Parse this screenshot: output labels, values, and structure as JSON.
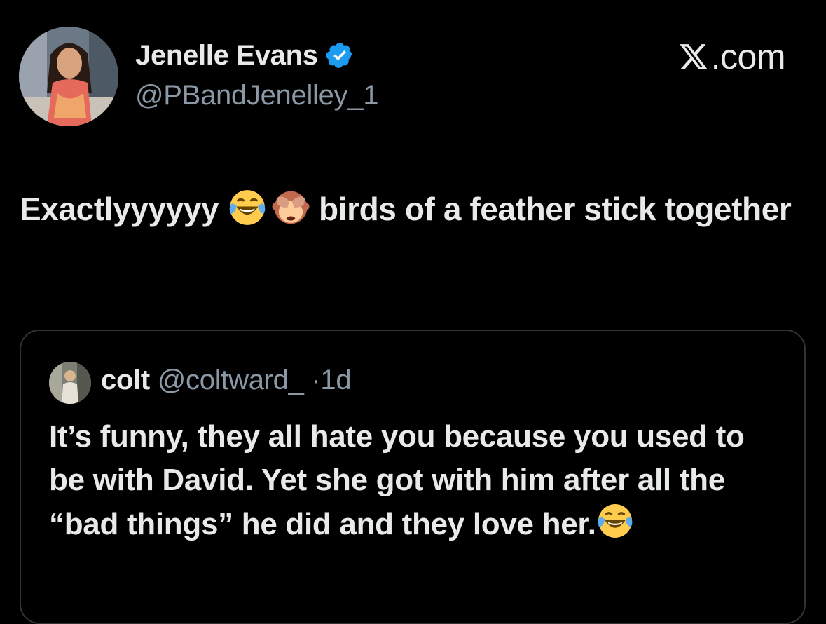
{
  "author": {
    "name": "Jenelle Evans",
    "handle": "@PBandJenelley_1",
    "verified_icon": "verified-badge-icon",
    "verified_color": "#1d9bf0"
  },
  "brand": {
    "text": ".com",
    "icon": "x-logo-icon"
  },
  "tweet": {
    "text_before": "Exactlyyyyyy ",
    "emoji_1": "face-with-tears-of-joy-icon",
    "emoji_2": "see-no-evil-monkey-icon",
    "text_after": " birds of a feather stick together"
  },
  "quote": {
    "name": "colt",
    "handle": "@coltward_",
    "dot": "·",
    "time": "1d",
    "text": "It’s funny, they all hate you because you used to be with David. Yet she got with him after all the  “bad things” he did and they love her.",
    "emoji": "face-with-tears-of-joy-icon"
  },
  "colors": {
    "background": "#000000",
    "primary_text": "#e7e9ea",
    "secondary_text": "#8b98a5",
    "border": "#2f3336"
  }
}
